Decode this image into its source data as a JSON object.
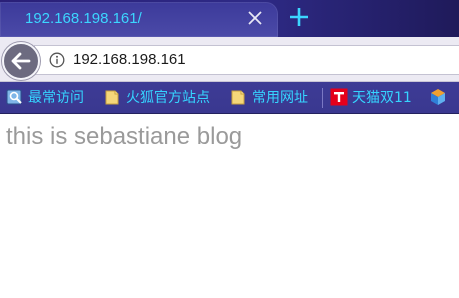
{
  "tab": {
    "title": "192.168.198.161/",
    "close_icon": "close-icon",
    "new_tab_icon": "plus-icon"
  },
  "navbar": {
    "back_icon": "back-arrow-icon",
    "info_icon": "info-icon",
    "url": "192.168.198.161"
  },
  "bookmarks": {
    "items": [
      {
        "label": "最常访问",
        "icon": "most-visited-icon"
      },
      {
        "label": "火狐官方站点",
        "icon": "folder-icon"
      },
      {
        "label": "常用网址",
        "icon": "folder-icon"
      },
      {
        "label": "天猫双11",
        "icon": "tmall-icon"
      }
    ],
    "overflow_icon": "cube-icon"
  },
  "page": {
    "text": "this is sebastiane blog"
  },
  "colors": {
    "tab_text": "#3cd6ff",
    "bookmark_text": "#35d4ff",
    "page_text": "#9a9a9a"
  }
}
